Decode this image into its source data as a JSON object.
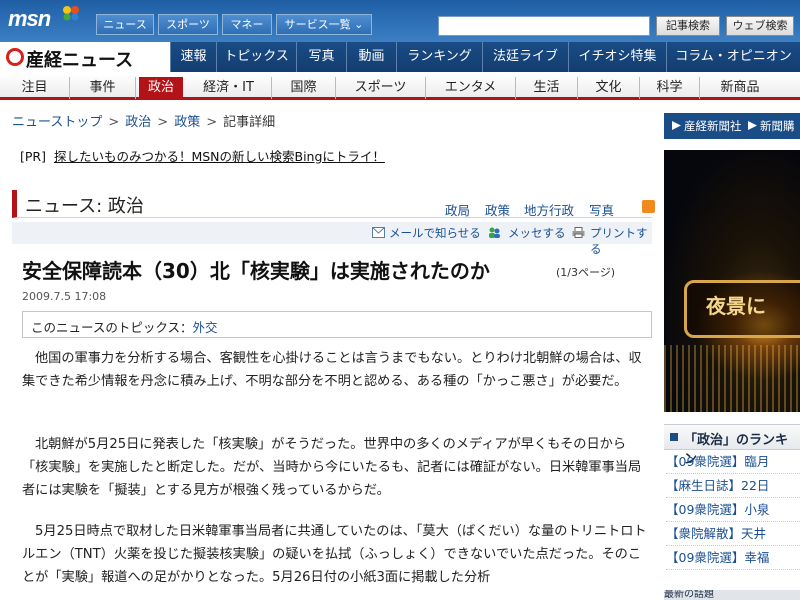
{
  "msn": {
    "logo": "msn",
    "tabs": [
      "ニュース",
      "スポーツ",
      "マネー",
      "サービス一覧"
    ],
    "search_placeholder": "",
    "search_buttons": [
      "記事検索",
      "ウェブ検索"
    ]
  },
  "sankei": {
    "logo": "産経ニュース",
    "nav": [
      "速報",
      "トピックス",
      "写真",
      "動画",
      "ランキング",
      "法廷ライブ",
      "イチオシ特集",
      "コラム・オピニオン"
    ]
  },
  "categories": [
    "注目",
    "事件",
    "政治",
    "経済・IT",
    "国際",
    "スポーツ",
    "エンタメ",
    "生活",
    "文化",
    "科学",
    "新商品"
  ],
  "active_category": "政治",
  "breadcrumb": [
    "ニューストップ",
    "政治",
    "政策",
    "記事詳細"
  ],
  "pr": {
    "tag": "[PR]",
    "text": "探したいものみつかる！MSNの新しい検索Bingにトライ！"
  },
  "section": {
    "title": "ニュース: 政治",
    "links": [
      "政局",
      "政策",
      "地方行政",
      "写真"
    ]
  },
  "tools": [
    "メールで知らせる",
    "メッセする",
    "プリントする"
  ],
  "article": {
    "headline": "安全保障読本（30）北「核実験」は実施されたのか",
    "page_indicator": "(1/3ページ)",
    "date": "2009.7.5 17:08",
    "topic_label": "このニュースのトピックス：",
    "topic_link": "外交",
    "paragraphs": [
      "他国の軍事力を分析する場合、客観性を心掛けることは言うまでもない。とりわけ北朝鮮の場合は、収集できた希少情報を丹念に積み上げ、不明な部分を不明と認める、ある種の「かっこ悪さ」が必要だ。",
      "北朝鮮が5月25日に発表した「核実験」がそうだった。世界中の多くのメディアが早くもその日から「核実験」を実施したと断定した。だが、当時から今にいたるも、記者には確証がない。日米韓軍事当局者には実験を「擬装」とする見方が根強く残っているからだ。",
      "5月25日時点で取材した日米韓軍事当局者に共通していたのは、「莫大（ばくだい）な量のトリニトロトルエン（TNT）火薬を投じた擬装核実験」の疑いを払拭（ふっしょく）できないでいた点だった。そのことが「実験」報道への足がかりとなった。5月26日付の小紙3面に掲載した分析"
    ]
  },
  "sidebar": {
    "nav": [
      "産経新聞社",
      "新聞購"
    ],
    "ad_text": "夜景に",
    "ranking_title": "「政治」のランキン",
    "ranking": [
      "【09衆院選】臨月",
      "【麻生日誌】22日",
      "【09衆院選】小泉",
      "【衆院解散】天井",
      "【09衆院選】幸福"
    ],
    "recent_title": "最新の話題"
  }
}
